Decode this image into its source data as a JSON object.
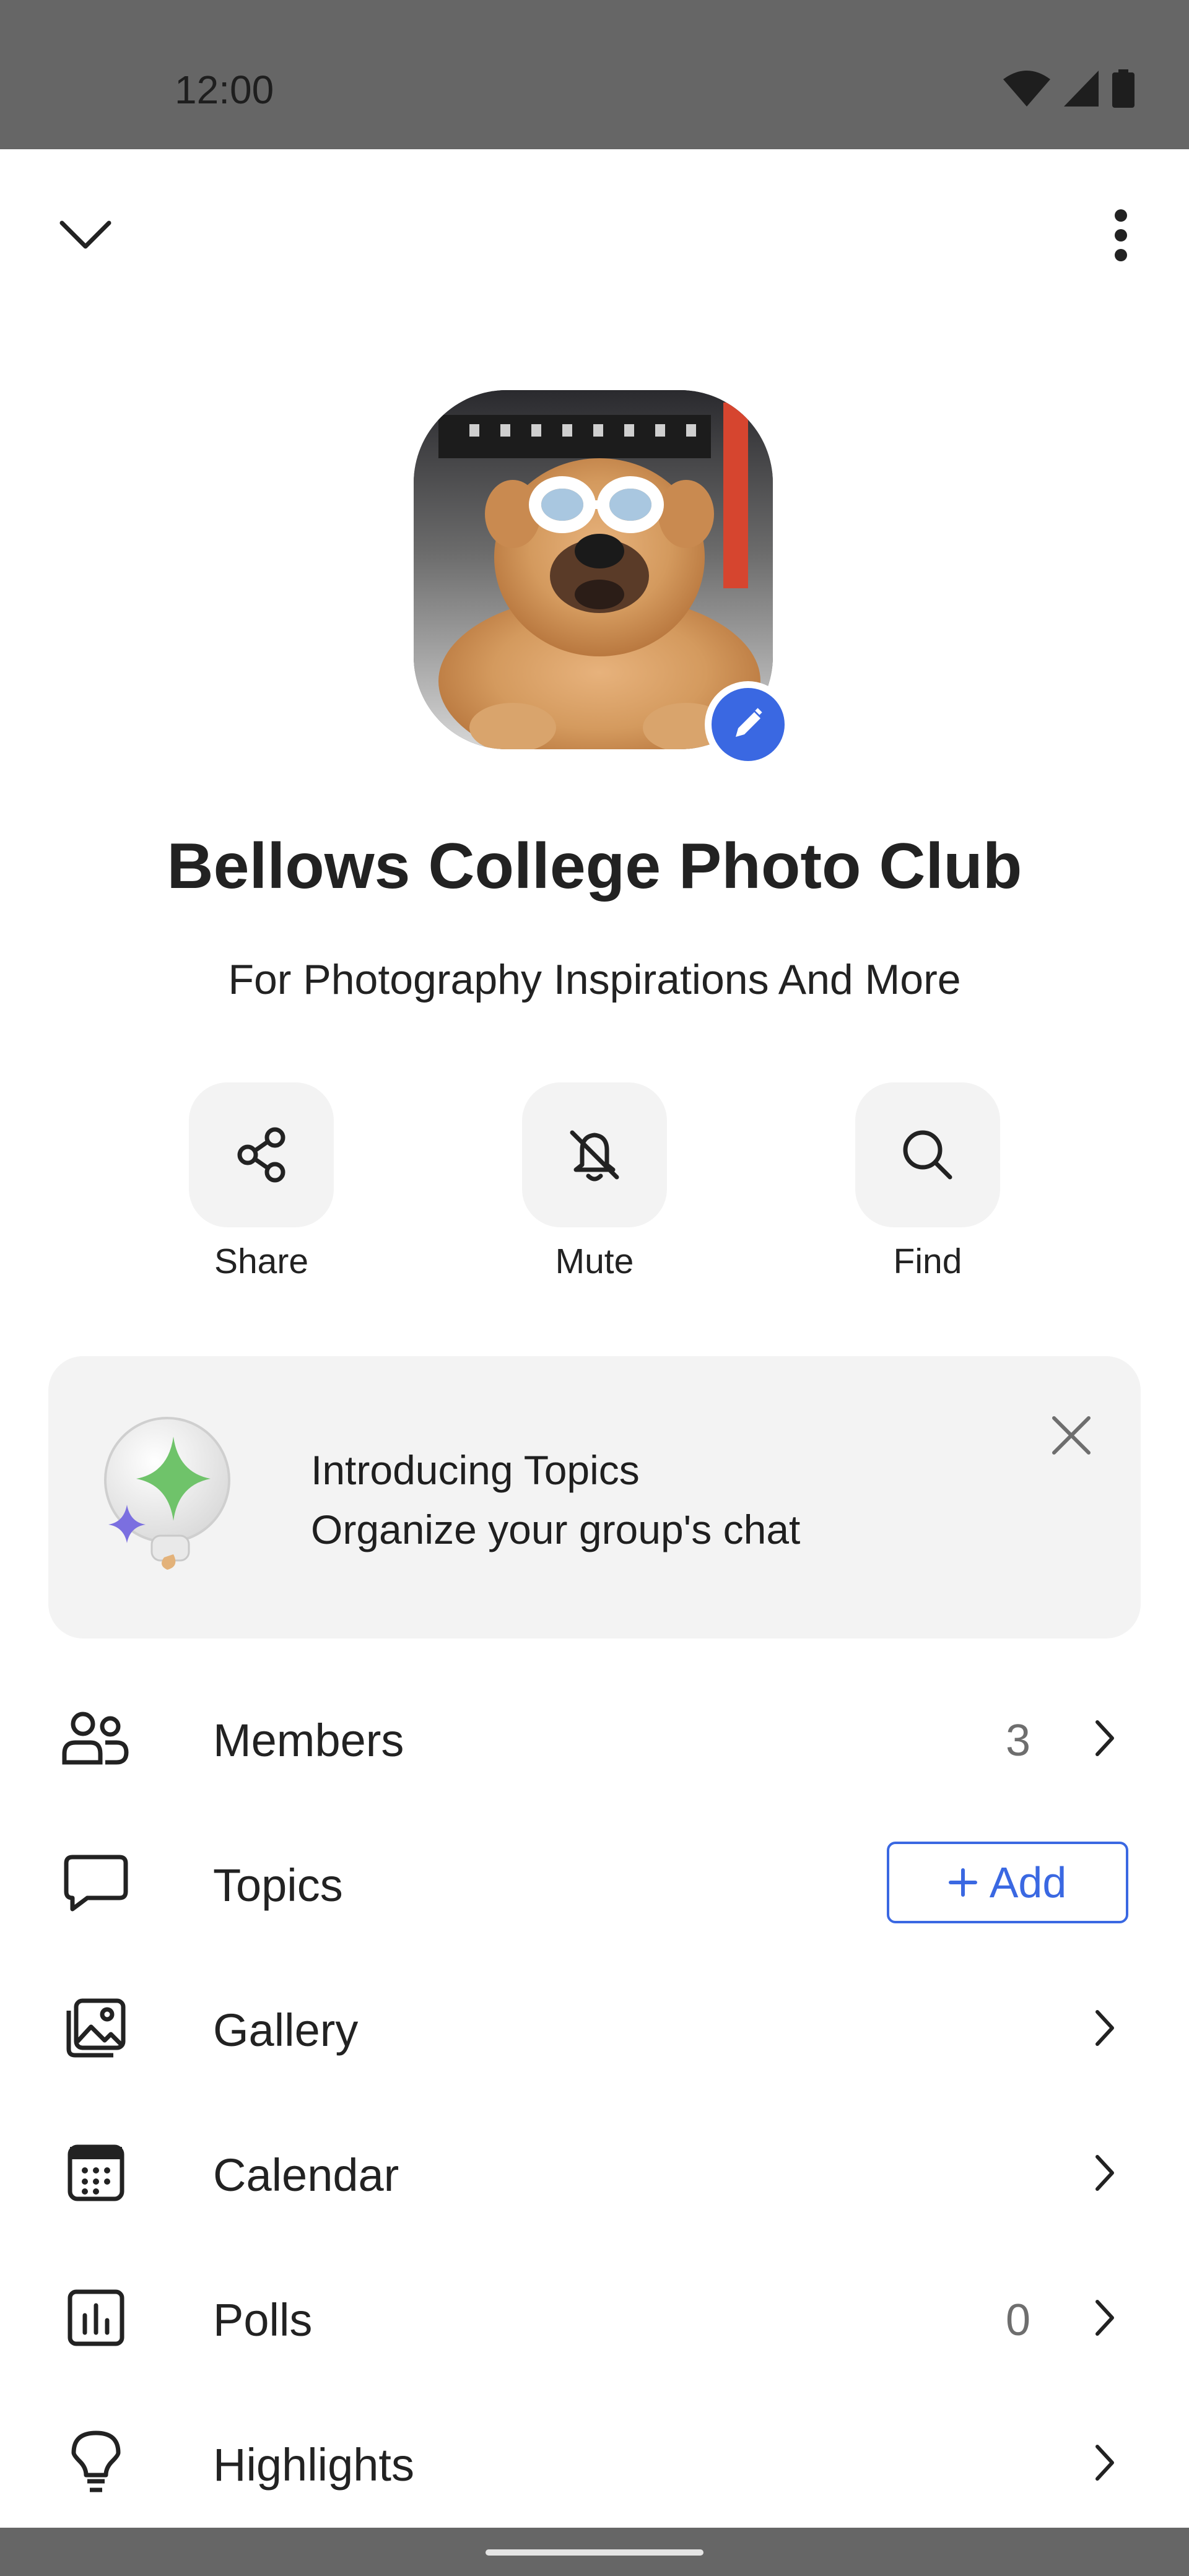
{
  "status_bar": {
    "time": "12:00",
    "icons": [
      "wifi-icon",
      "cellular-signal-icon",
      "battery-icon"
    ]
  },
  "top_bar": {
    "back_icon": "chevron-down-icon",
    "menu_icon": "more-vertical-icon"
  },
  "group": {
    "avatar_desc": "dog-with-sunglasses-photo",
    "name": "Bellows College Photo Club",
    "description": "For Photography Inspirations And More"
  },
  "actions": [
    {
      "label": "Share",
      "icon": "share-icon"
    },
    {
      "label": "Mute",
      "icon": "bell-off-icon"
    },
    {
      "label": "Find",
      "icon": "search-icon"
    }
  ],
  "banner": {
    "title": "Introducing Topics",
    "subtitle": "Organize your group's chat",
    "icon": "sparkle-lightbulb-icon",
    "close_icon": "close-icon"
  },
  "list": [
    {
      "label": "Members",
      "icon": "people-icon",
      "count": "3"
    },
    {
      "label": "Topics",
      "icon": "chat-bubble-icon",
      "button": "Add"
    },
    {
      "label": "Gallery",
      "icon": "image-icon"
    },
    {
      "label": "Calendar",
      "icon": "calendar-icon"
    },
    {
      "label": "Polls",
      "icon": "poll-icon",
      "count": "0"
    },
    {
      "label": "Highlights",
      "icon": "lightbulb-icon"
    }
  ],
  "colors": {
    "accent": "#3a68e2",
    "status_bar": "#666666",
    "tile": "#f3f3f3"
  }
}
